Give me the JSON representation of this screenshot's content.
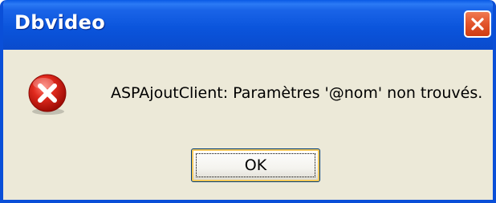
{
  "window": {
    "title": "Dbvideo",
    "close_icon": "close-x-icon"
  },
  "dialog": {
    "icon": "error-icon",
    "message": "ASPAjoutClient: Paramètres '@nom' non trouvés.",
    "ok_label": "OK"
  },
  "colors": {
    "titlebar": "#0a55dc",
    "body": "#ece9d8",
    "close_button": "#e2532b",
    "error_icon": "#d42020"
  }
}
